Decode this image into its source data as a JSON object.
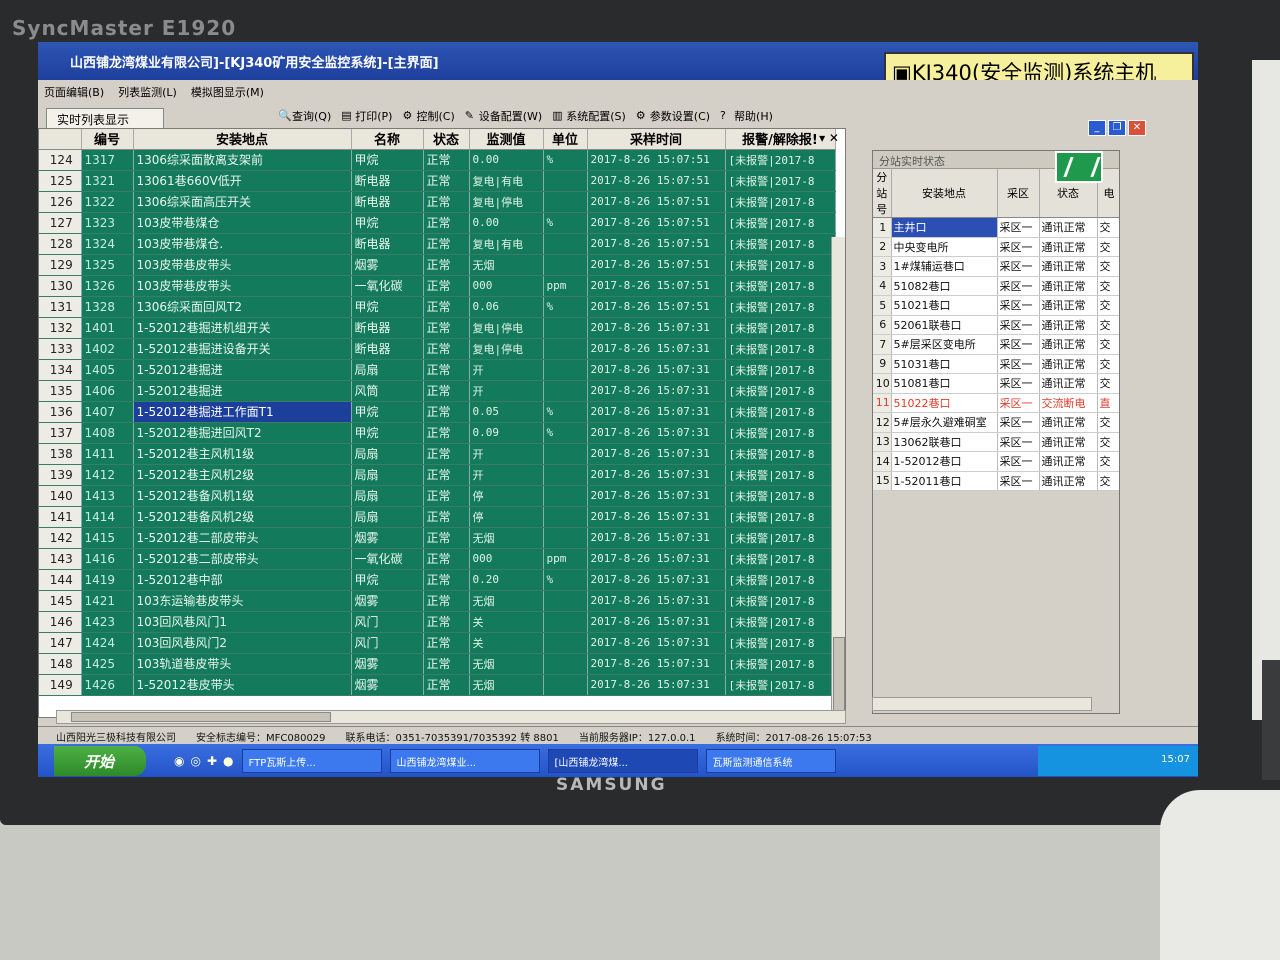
{
  "monitor": {
    "top_brand": "SyncMaster E1920",
    "bottom_brand": "SAMSUNG"
  },
  "window": {
    "title": "山西铺龙湾煤业有限公司]-[KJ340矿用安全监控系统]-[主界面]",
    "product_badge": "KJ340(安全监测)系统主机"
  },
  "menu": [
    "页面编辑(B)",
    "列表监测(L)",
    "模拟图显示(M)",
    "查询(Q)",
    "打印(P)",
    "控制(C)",
    "设备配置(W)",
    "系统配置(S)",
    "参数设置(C)",
    "帮助(H)"
  ],
  "tab_label": "实时列表显示",
  "grid": {
    "headers": [
      "编号",
      "安装地点",
      "名称",
      "状态",
      "监测值",
      "单位",
      "采样时间",
      "报警/解除报!"
    ],
    "rows": [
      [
        "124",
        "1317",
        "1306综采面散离支架前",
        "甲烷",
        "正常",
        "0.00",
        "%",
        "2017-8-26 15:07:51",
        "[未报警|2017-8"
      ],
      [
        "125",
        "1321",
        "13061巷660V低开",
        "断电器",
        "正常",
        "复电|有电",
        "",
        "2017-8-26 15:07:51",
        "[未报警|2017-8"
      ],
      [
        "126",
        "1322",
        "1306综采面高压开关",
        "断电器",
        "正常",
        "复电|停电",
        "",
        "2017-8-26 15:07:51",
        "[未报警|2017-8"
      ],
      [
        "127",
        "1323",
        "103皮带巷煤仓",
        "甲烷",
        "正常",
        "0.00",
        "%",
        "2017-8-26 15:07:51",
        "[未报警|2017-8"
      ],
      [
        "128",
        "1324",
        "103皮带巷煤仓.",
        "断电器",
        "正常",
        "复电|有电",
        "",
        "2017-8-26 15:07:51",
        "[未报警|2017-8"
      ],
      [
        "129",
        "1325",
        "103皮带巷皮带头",
        "烟雾",
        "正常",
        "无烟",
        "",
        "2017-8-26 15:07:51",
        "[未报警|2017-8"
      ],
      [
        "130",
        "1326",
        "103皮带巷皮带头",
        "一氧化碳",
        "正常",
        "000",
        "ppm",
        "2017-8-26 15:07:51",
        "[未报警|2017-8"
      ],
      [
        "131",
        "1328",
        "1306综采面回风T2",
        "甲烷",
        "正常",
        "0.06",
        "%",
        "2017-8-26 15:07:51",
        "[未报警|2017-8"
      ],
      [
        "132",
        "1401",
        "1-52012巷掘进机组开关",
        "断电器",
        "正常",
        "复电|停电",
        "",
        "2017-8-26 15:07:31",
        "[未报警|2017-8"
      ],
      [
        "133",
        "1402",
        "1-52012巷掘进设备开关",
        "断电器",
        "正常",
        "复电|停电",
        "",
        "2017-8-26 15:07:31",
        "[未报警|2017-8"
      ],
      [
        "134",
        "1405",
        "1-52012巷掘进",
        "局扇",
        "正常",
        "开",
        "",
        "2017-8-26 15:07:31",
        "[未报警|2017-8"
      ],
      [
        "135",
        "1406",
        "1-52012巷掘进",
        "风筒",
        "正常",
        "开",
        "",
        "2017-8-26 15:07:31",
        "[未报警|2017-8"
      ],
      [
        "136",
        "1407",
        "1-52012巷掘进工作面T1",
        "甲烷",
        "正常",
        "0.05",
        "%",
        "2017-8-26 15:07:31",
        "[未报警|2017-8"
      ],
      [
        "137",
        "1408",
        "1-52012巷掘进回风T2",
        "甲烷",
        "正常",
        "0.09",
        "%",
        "2017-8-26 15:07:31",
        "[未报警|2017-8"
      ],
      [
        "138",
        "1411",
        "1-52012巷主风机1级",
        "局扇",
        "正常",
        "开",
        "",
        "2017-8-26 15:07:31",
        "[未报警|2017-8"
      ],
      [
        "139",
        "1412",
        "1-52012巷主风机2级",
        "局扇",
        "正常",
        "开",
        "",
        "2017-8-26 15:07:31",
        "[未报警|2017-8"
      ],
      [
        "140",
        "1413",
        "1-52012巷备风机1级",
        "局扇",
        "正常",
        "停",
        "",
        "2017-8-26 15:07:31",
        "[未报警|2017-8"
      ],
      [
        "141",
        "1414",
        "1-52012巷备风机2级",
        "局扇",
        "正常",
        "停",
        "",
        "2017-8-26 15:07:31",
        "[未报警|2017-8"
      ],
      [
        "142",
        "1415",
        "1-52012巷二部皮带头",
        "烟雾",
        "正常",
        "无烟",
        "",
        "2017-8-26 15:07:31",
        "[未报警|2017-8"
      ],
      [
        "143",
        "1416",
        "1-52012巷二部皮带头",
        "一氧化碳",
        "正常",
        "000",
        "ppm",
        "2017-8-26 15:07:31",
        "[未报警|2017-8"
      ],
      [
        "144",
        "1419",
        "1-52012巷中部",
        "甲烷",
        "正常",
        "0.20",
        "%",
        "2017-8-26 15:07:31",
        "[未报警|2017-8"
      ],
      [
        "145",
        "1421",
        "103东运输巷皮带头",
        "烟雾",
        "正常",
        "无烟",
        "",
        "2017-8-26 15:07:31",
        "[未报警|2017-8"
      ],
      [
        "146",
        "1423",
        "103回风巷风门1",
        "风门",
        "正常",
        "关",
        "",
        "2017-8-26 15:07:31",
        "[未报警|2017-8"
      ],
      [
        "147",
        "1424",
        "103回风巷风门2",
        "风门",
        "正常",
        "关",
        "",
        "2017-8-26 15:07:31",
        "[未报警|2017-8"
      ],
      [
        "148",
        "1425",
        "103轨道巷皮带头",
        "烟雾",
        "正常",
        "无烟",
        "",
        "2017-8-26 15:07:31",
        "[未报警|2017-8"
      ],
      [
        "149",
        "1426",
        "1-52012巷皮带头",
        "烟雾",
        "正常",
        "无烟",
        "",
        "2017-8-26 15:07:31",
        "[未报警|2017-8"
      ]
    ],
    "selected_row_index": 12,
    "alarm_value_rows": [
      16,
      17
    ]
  },
  "substation": {
    "title": "分站实时状态",
    "headers": [
      "分站号",
      "安装地点",
      "采区",
      "状态",
      "电"
    ],
    "rows": [
      [
        "1",
        "主井口",
        "采区一",
        "通讯正常",
        "交"
      ],
      [
        "2",
        "中央变电所",
        "采区一",
        "通讯正常",
        "交"
      ],
      [
        "3",
        "1#煤辅运巷口",
        "采区一",
        "通讯正常",
        "交"
      ],
      [
        "4",
        "51082巷口",
        "采区一",
        "通讯正常",
        "交"
      ],
      [
        "5",
        "51021巷口",
        "采区一",
        "通讯正常",
        "交"
      ],
      [
        "6",
        "52061联巷口",
        "采区一",
        "通讯正常",
        "交"
      ],
      [
        "7",
        "5#层采区变电所",
        "采区一",
        "通讯正常",
        "交"
      ],
      [
        "9",
        "51031巷口",
        "采区一",
        "通讯正常",
        "交"
      ],
      [
        "10",
        "51081巷口",
        "采区一",
        "通讯正常",
        "交"
      ],
      [
        "11",
        "51022巷口",
        "采区一",
        "交流断电",
        "直"
      ],
      [
        "12",
        "5#层永久避难硐室",
        "采区一",
        "通讯正常",
        "交"
      ],
      [
        "13",
        "13062联巷口",
        "采区一",
        "通讯正常",
        "交"
      ],
      [
        "14",
        "1-52012巷口",
        "采区一",
        "通讯正常",
        "交"
      ],
      [
        "15",
        "1-52011巷口",
        "采区一",
        "通讯正常",
        "交"
      ]
    ],
    "selected_row_index": 0,
    "alarm_row_index": 9
  },
  "status": {
    "company": "山西阳光三极科技有限公司",
    "safety_mark": "安全标志编号：MFC080029",
    "phone": "联系电话：0351-7035391/7035392 转 8801",
    "server_ip": "当前服务器IP：127.0.0.1",
    "system_time": "系统时间：2017-08-26 15:07:53"
  },
  "taskbar": {
    "start": "开始",
    "tasks": [
      "FTP瓦斯上传...",
      "山西铺龙湾煤业...",
      "[山西铺龙湾煤...",
      "瓦斯监测通信系统"
    ],
    "clock": "15:07"
  },
  "colors": {
    "grid_bg": "#137a5c",
    "selected": "#1c3f9c",
    "alarm": "#ff6a5a",
    "badge": "#f6ef9c"
  }
}
